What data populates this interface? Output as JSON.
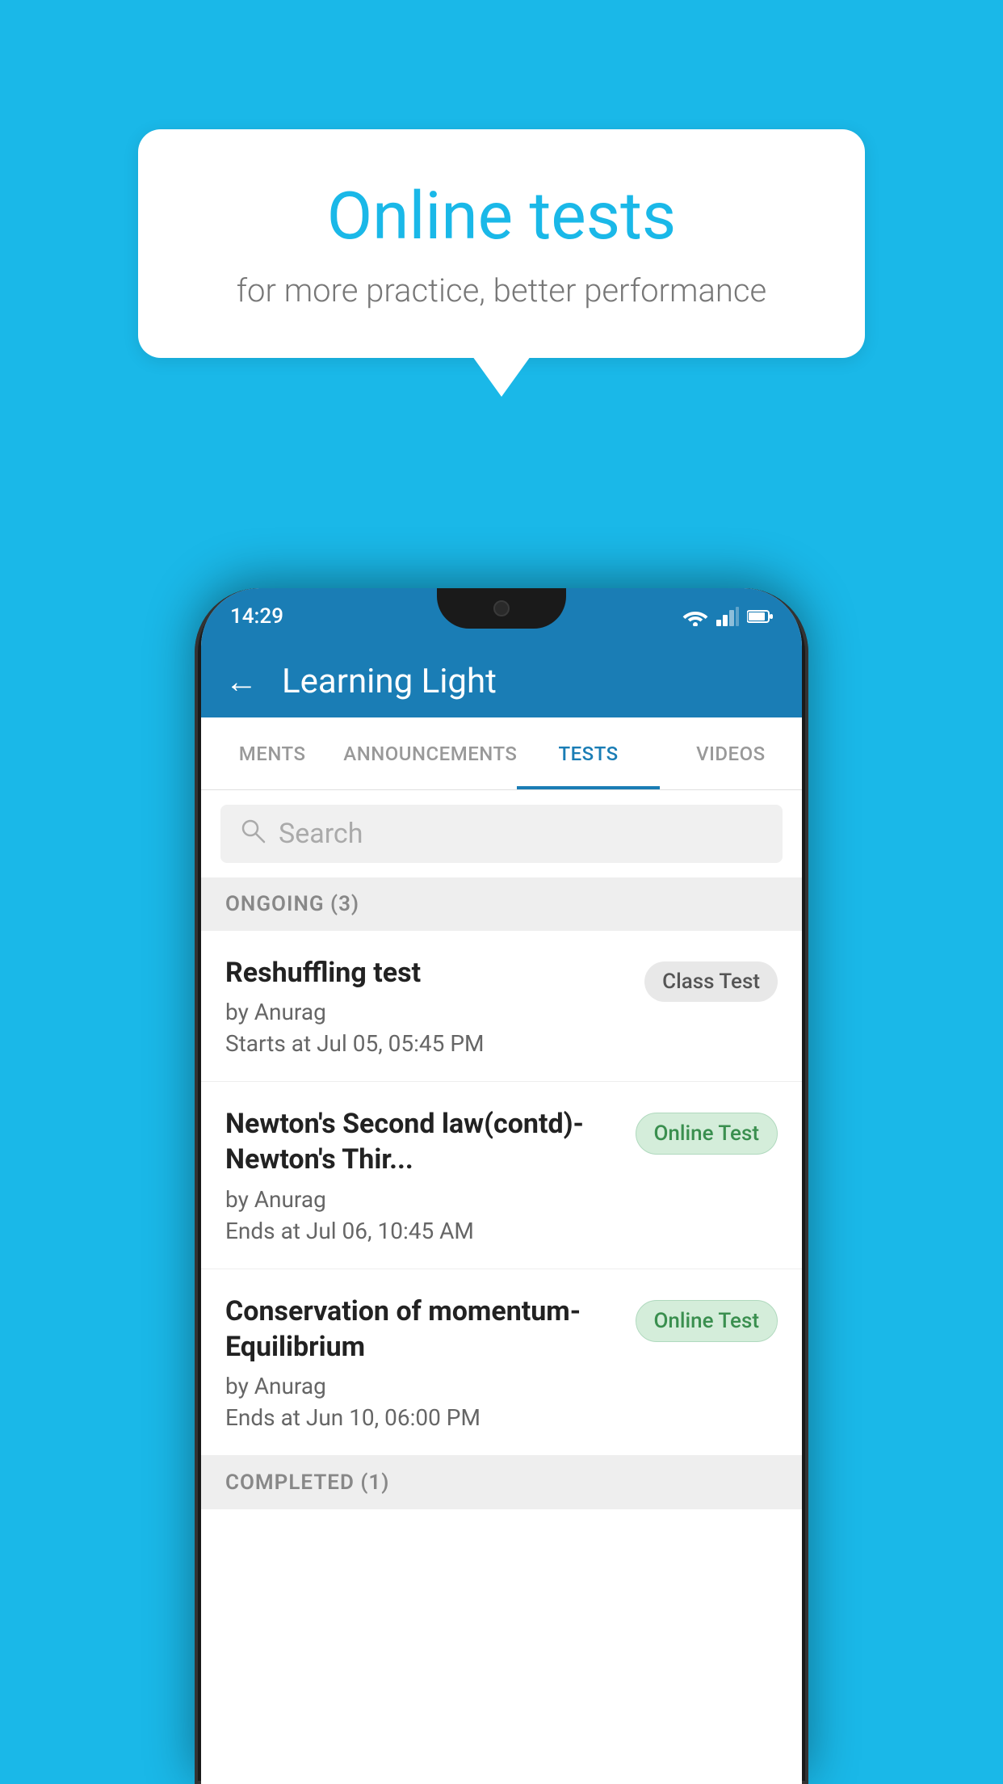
{
  "background": {
    "color": "#1ab8e8"
  },
  "speechBubble": {
    "title": "Online tests",
    "subtitle": "for more practice, better performance"
  },
  "statusBar": {
    "time": "14:29",
    "icons": [
      "wifi",
      "signal",
      "battery"
    ]
  },
  "appHeader": {
    "backArrow": "←",
    "title": "Learning Light"
  },
  "tabs": [
    {
      "label": "MENTS",
      "active": false
    },
    {
      "label": "ANNOUNCEMENTS",
      "active": false
    },
    {
      "label": "TESTS",
      "active": true
    },
    {
      "label": "VIDEOS",
      "active": false
    }
  ],
  "search": {
    "placeholder": "Search"
  },
  "sections": {
    "ongoing": {
      "label": "ONGOING (3)",
      "tests": [
        {
          "title": "Reshuffling test",
          "author": "by Anurag",
          "time": "Starts at  Jul 05, 05:45 PM",
          "badge": "Class Test",
          "badgeType": "class"
        },
        {
          "title": "Newton's Second law(contd)-Newton's Thir...",
          "author": "by Anurag",
          "time": "Ends at  Jul 06, 10:45 AM",
          "badge": "Online Test",
          "badgeType": "online"
        },
        {
          "title": "Conservation of momentum-Equilibrium",
          "author": "by Anurag",
          "time": "Ends at  Jun 10, 06:00 PM",
          "badge": "Online Test",
          "badgeType": "online"
        }
      ]
    },
    "completed": {
      "label": "COMPLETED (1)"
    }
  }
}
